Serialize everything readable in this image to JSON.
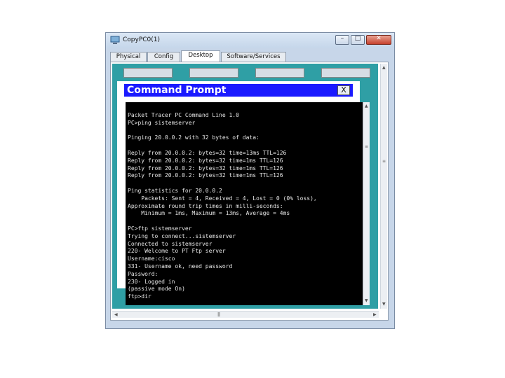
{
  "window": {
    "title": "CopyPC0(1)",
    "controls": {
      "minimize": "–",
      "maximize": "□",
      "close": "✕"
    }
  },
  "tabs": [
    {
      "label": "Physical"
    },
    {
      "label": "Config"
    },
    {
      "label": "Desktop",
      "active": true
    },
    {
      "label": "Software/Services"
    }
  ],
  "command_prompt": {
    "title": "Command Prompt",
    "close": "X",
    "lines": [
      "Packet Tracer PC Command Line 1.0",
      "PC>ping sistemserver",
      "",
      "Pinging 20.0.0.2 with 32 bytes of data:",
      "",
      "Reply from 20.0.0.2: bytes=32 time=13ms TTL=126",
      "Reply from 20.0.0.2: bytes=32 time=1ms TTL=126",
      "Reply from 20.0.0.2: bytes=32 time=1ms TTL=126",
      "Reply from 20.0.0.2: bytes=32 time=1ms TTL=126",
      "",
      "Ping statistics for 20.0.0.2",
      "    Packets: Sent = 4, Received = 4, Lost = 0 (0% loss),",
      "Approximate round trip times in milli-seconds:",
      "    Minimum = 1ms, Maximum = 13ms, Average = 4ms",
      "",
      "PC>ftp sistemserver",
      "Trying to connect...sistemserver",
      "Connected to sistemserver",
      "220- Welcome to PT Ftp server",
      "Username:cisco",
      "331- Username ok, need password",
      "Password:",
      "230- Logged in",
      "(passive mode On)",
      "ftp>dir"
    ]
  },
  "colors": {
    "window_frame": "#c7d6e9",
    "desktop_bg": "#2f9fa5",
    "cmd_titlebar": "#1a1aff",
    "terminal_bg": "#000000",
    "terminal_text": "#e6e6e6"
  }
}
